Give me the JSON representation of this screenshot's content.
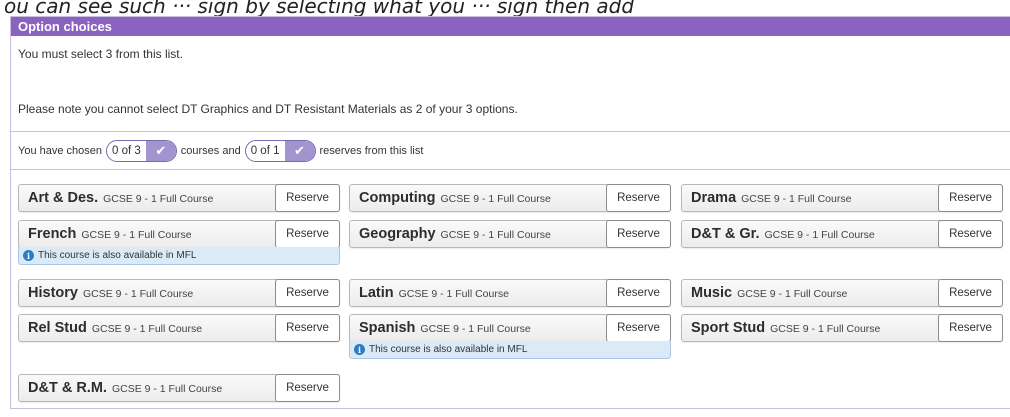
{
  "top_strip_text": "ou can see such ··· sign by selecting what you ··· sign then add",
  "panel": {
    "title": "Option choices",
    "instruction": "You must select 3 from this list.",
    "note": "Please note you cannot select DT Graphics and DT Resistant Materials as 2 of your 3 options.",
    "counter": {
      "prefix": "You have chosen",
      "courses_value": "0 of 3",
      "middle": "courses and",
      "reserves_value": "0 of 1",
      "suffix": "reserves from this list"
    }
  },
  "courses": [
    {
      "name": "Art & Des.",
      "level": "GCSE 9 - 1 Full Course",
      "button": "Reserve"
    },
    {
      "name": "Computing",
      "level": "GCSE 9 - 1 Full Course",
      "button": "Reserve"
    },
    {
      "name": "Drama",
      "level": "GCSE 9 - 1 Full Course",
      "button": "Reserve"
    },
    {
      "name": "French",
      "level": "GCSE 9 - 1 Full Course",
      "button": "Reserve",
      "note": "This course is also available in MFL"
    },
    {
      "name": "Geography",
      "level": "GCSE 9 - 1 Full Course",
      "button": "Reserve"
    },
    {
      "name": "D&T & Gr.",
      "level": "GCSE 9 - 1 Full Course",
      "button": "Reserve"
    },
    {
      "name": "History",
      "level": "GCSE 9 - 1 Full Course",
      "button": "Reserve"
    },
    {
      "name": "Latin",
      "level": "GCSE 9 - 1 Full Course",
      "button": "Reserve"
    },
    {
      "name": "Music",
      "level": "GCSE 9 - 1 Full Course",
      "button": "Reserve"
    },
    {
      "name": "Rel Stud",
      "level": "GCSE 9 - 1 Full Course",
      "button": "Reserve"
    },
    {
      "name": "Spanish",
      "level": "GCSE 9 - 1 Full Course",
      "button": "Reserve",
      "note": "This course is also available in MFL"
    },
    {
      "name": "Sport Stud",
      "level": "GCSE 9 - 1 Full Course",
      "button": "Reserve"
    },
    {
      "name": "D&T & R.M.",
      "level": "GCSE 9 - 1 Full Course",
      "button": "Reserve"
    }
  ],
  "colors": {
    "header": "#8a62bf",
    "pill_check": "#a294cf",
    "note_bg": "#dbeaf7",
    "info_icon": "#2f7cc1"
  },
  "icons": {
    "check": "check-icon",
    "info": "info-icon"
  }
}
